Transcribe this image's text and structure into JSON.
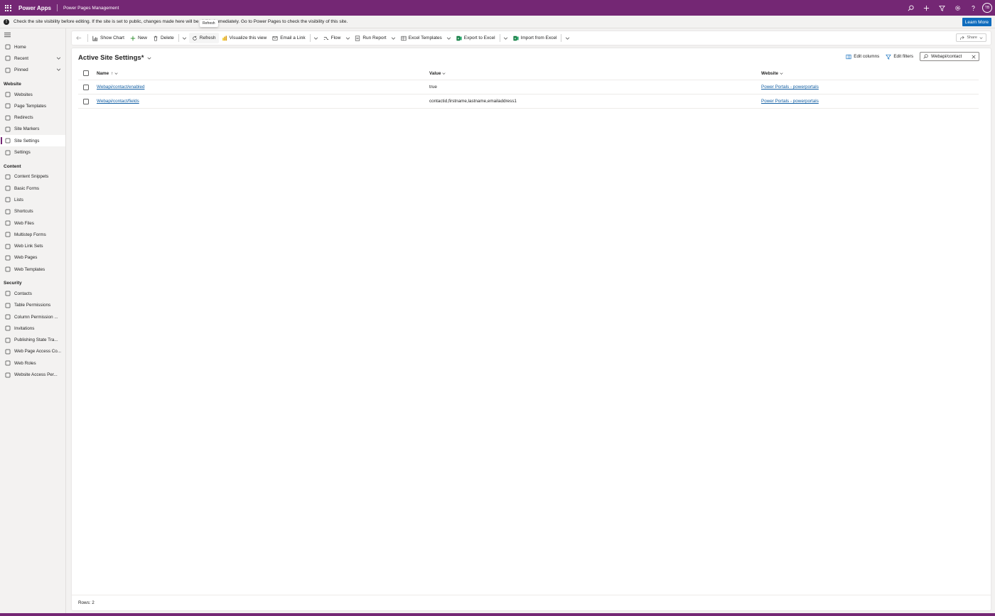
{
  "topbar": {
    "app_name": "Power Apps",
    "environment": "Power Pages Management",
    "avatar_initials": "TB",
    "icons": [
      "search-icon",
      "plus-icon",
      "filter-icon",
      "gear-icon",
      "help-icon"
    ],
    "color": "#742774"
  },
  "banner": {
    "text": "Check the site visibility before editing. If the site is set to public, changes made here will be visible immediately. Go to Power Pages to check the visibility of this site.",
    "button": "Learn More",
    "tooltip": "Refresh"
  },
  "sidebar": {
    "top_items": [
      {
        "label": "Home",
        "icon": "home-icon"
      },
      {
        "label": "Recent",
        "icon": "clock-icon",
        "expandable": true
      },
      {
        "label": "Pinned",
        "icon": "pin-icon",
        "expandable": true
      }
    ],
    "sections": [
      {
        "title": "Website",
        "items": [
          {
            "label": "Websites",
            "icon": "globe-icon"
          },
          {
            "label": "Page Templates",
            "icon": "document-icon"
          },
          {
            "label": "Redirects",
            "icon": "redirect-icon"
          },
          {
            "label": "Site Markers",
            "icon": "marker-icon"
          },
          {
            "label": "Site Settings",
            "icon": "settings-list-icon",
            "active": true
          },
          {
            "label": "Settings",
            "icon": "gear-icon"
          }
        ]
      },
      {
        "title": "Content",
        "items": [
          {
            "label": "Content Snippets",
            "icon": "snippet-icon"
          },
          {
            "label": "Basic Forms",
            "icon": "form-icon"
          },
          {
            "label": "Lists",
            "icon": "list-icon"
          },
          {
            "label": "Shortcuts",
            "icon": "shortcut-icon"
          },
          {
            "label": "Web Files",
            "icon": "file-icon"
          },
          {
            "label": "Multistep Forms",
            "icon": "multistep-icon"
          },
          {
            "label": "Web Link Sets",
            "icon": "link-set-icon"
          },
          {
            "label": "Web Pages",
            "icon": "web-page-icon"
          },
          {
            "label": "Web Templates",
            "icon": "template-icon"
          }
        ]
      },
      {
        "title": "Security",
        "items": [
          {
            "label": "Contacts",
            "icon": "person-icon"
          },
          {
            "label": "Table Permissions",
            "icon": "table-icon"
          },
          {
            "label": "Column Permission ...",
            "icon": "column-icon"
          },
          {
            "label": "Invitations",
            "icon": "mail-icon"
          },
          {
            "label": "Publishing State Tra...",
            "icon": "flow-icon"
          },
          {
            "label": "Web Page Access Co...",
            "icon": "key-icon"
          },
          {
            "label": "Web Roles",
            "icon": "role-icon"
          },
          {
            "label": "Website Access Per...",
            "icon": "key-icon"
          }
        ]
      }
    ]
  },
  "cmdbar": {
    "show_chart": "Show Chart",
    "new": "New",
    "delete": "Delete",
    "refresh": "Refresh",
    "visualize": "Visualize this view",
    "email_link": "Email a Link",
    "flow": "Flow",
    "run_report": "Run Report",
    "excel_templates": "Excel Templates",
    "export_excel": "Export to Excel",
    "import_excel": "Import from Excel",
    "share": "Share"
  },
  "view": {
    "title": "Active Site Settings*",
    "edit_columns": "Edit columns",
    "edit_filters": "Edit filters",
    "search_value": "Webapi/contact"
  },
  "grid": {
    "columns": {
      "name": "Name",
      "name_sort": "↑",
      "value": "Value",
      "website": "Website"
    },
    "rows": [
      {
        "name": "Webapi/contact/enabled",
        "value": "true",
        "website": "Power Portals - powerportals"
      },
      {
        "name": "Webapi/contact/fields",
        "value": "contactid,firstname,lastname,emailaddress1",
        "website": "Power Portals - powerportals"
      }
    ],
    "footer": "Rows: 2"
  }
}
